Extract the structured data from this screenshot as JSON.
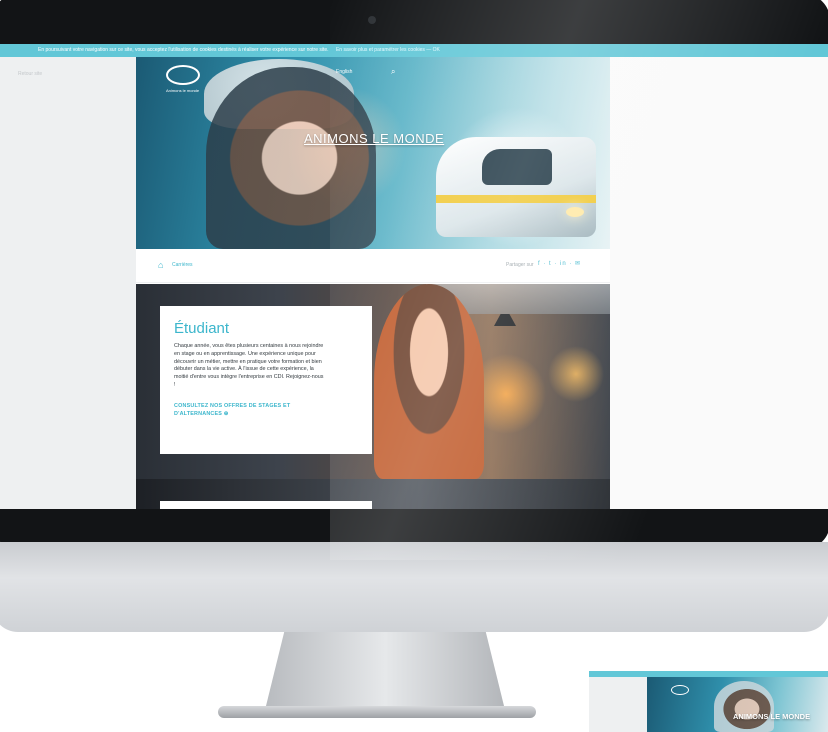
{
  "cookie_bar": {
    "text": "En poursuivant votre navigation sur ce site, vous acceptez l'utilisation de cookies destinés à réaliser votre expérience sur notre site.",
    "link": "En savoir plus et paramétrer les cookies — OK"
  },
  "left_nav": {
    "back_label": "Retour site"
  },
  "header": {
    "logo_tagline": "Animons le monde",
    "language_label": "English",
    "search_icon": "search-icon"
  },
  "hero": {
    "title": "ANIMONS LE MONDE"
  },
  "breadcrumb": {
    "home_icon": "home-icon",
    "current": "Carrières"
  },
  "share": {
    "label": "Partager sur",
    "icons": [
      "facebook-icon",
      "twitter-icon",
      "linkedin-icon",
      "email-icon"
    ],
    "socials_text": "f · t · in · ✉"
  },
  "feature": {
    "title": "Étudiant",
    "body": "Chaque année, vous êtes plusieurs centaines à nous rejoindre en stage ou en apprentissage. Une expérience unique pour découvrir un métier, mettre en pratique votre formation et bien débuter dans la vie active. À l'issue de cette expérience, la moitié d'entre vous intègre l'entreprise en CDI. Rejoignez-nous !",
    "cta": "CONSULTEZ NOS OFFRES DE STAGES ET D'ALTERNANCES ⊕"
  },
  "thumbnail": {
    "title": "ANIMONS LE MONDE"
  },
  "colors": {
    "accent": "#3cb6cc",
    "cookie_bar": "#62c7d7",
    "bezel": "#121416"
  }
}
